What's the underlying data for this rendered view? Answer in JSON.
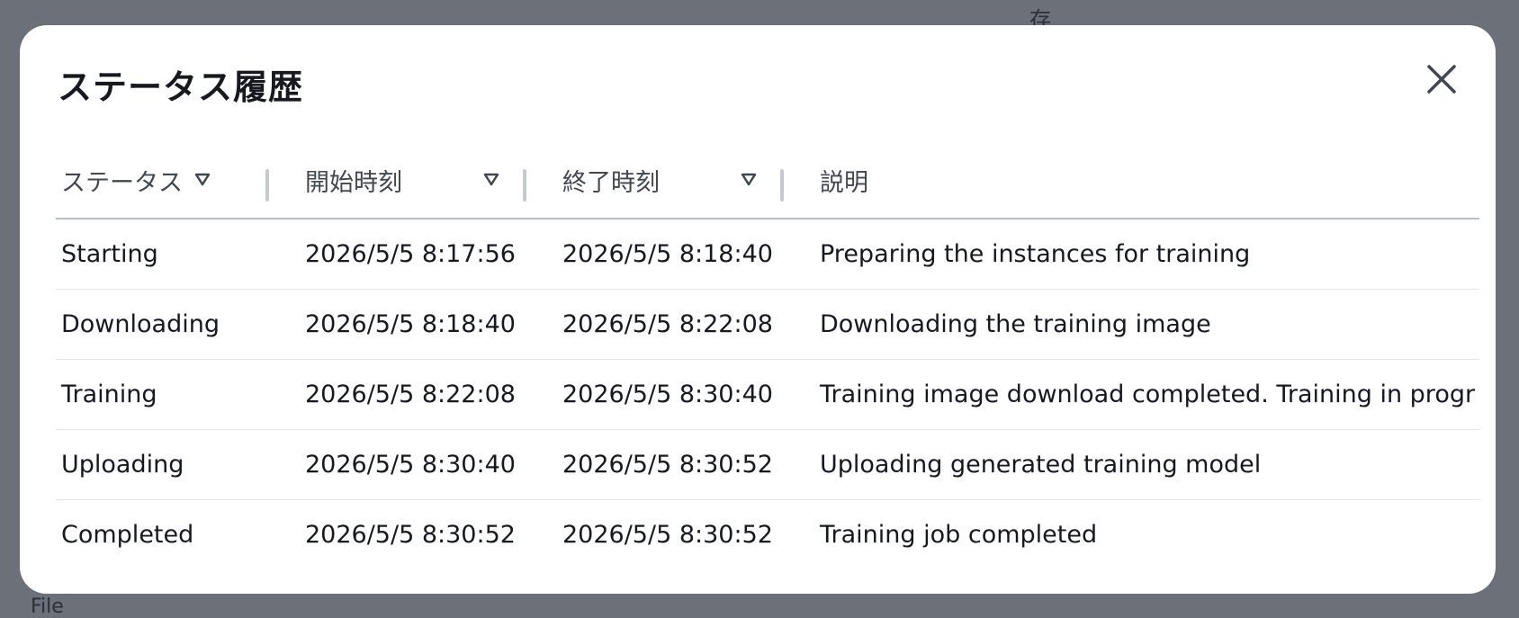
{
  "background": {
    "top_text": "存",
    "bottom_text": "File"
  },
  "modal": {
    "title": "ステータス履歴",
    "close_icon": "close-icon"
  },
  "table": {
    "columns": [
      {
        "label": "ステータス",
        "sortable": true
      },
      {
        "label": "開始時刻",
        "sortable": true
      },
      {
        "label": "終了時刻",
        "sortable": true
      },
      {
        "label": "説明",
        "sortable": false
      }
    ],
    "rows": [
      {
        "status": "Starting",
        "start": "2026/5/5 8:17:56",
        "end": "2026/5/5 8:18:40",
        "description": "Preparing the instances for training"
      },
      {
        "status": "Downloading",
        "start": "2026/5/5 8:18:40",
        "end": "2026/5/5 8:22:08",
        "description": "Downloading the training image"
      },
      {
        "status": "Training",
        "start": "2026/5/5 8:22:08",
        "end": "2026/5/5 8:30:40",
        "description": "Training image download completed. Training in progr"
      },
      {
        "status": "Uploading",
        "start": "2026/5/5 8:30:40",
        "end": "2026/5/5 8:30:52",
        "description": "Uploading generated training model"
      },
      {
        "status": "Completed",
        "start": "2026/5/5 8:30:52",
        "end": "2026/5/5 8:30:52",
        "description": "Training job completed"
      }
    ]
  },
  "colors": {
    "overlay": "#6b7079",
    "modal_bg": "#ffffff",
    "text_primary": "#16191f",
    "text_header": "#414750",
    "divider": "#e2e6eb"
  }
}
